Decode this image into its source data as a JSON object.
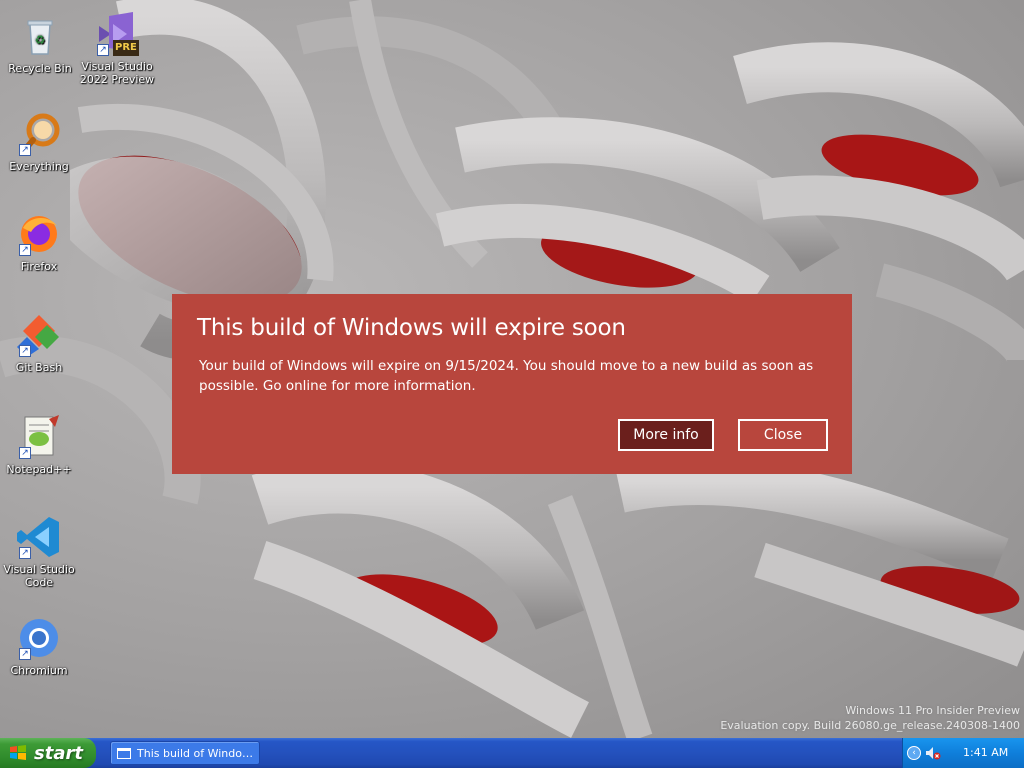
{
  "desktop": {
    "icons": [
      {
        "label": "Recycle Bin",
        "icon": "recycle-bin-icon"
      },
      {
        "label": "Visual Studio 2022 Preview",
        "icon": "visual-studio-preview-icon",
        "badge": "PRE"
      },
      {
        "label": "Everything",
        "icon": "everything-search-icon"
      },
      {
        "label": "Firefox",
        "icon": "firefox-icon"
      },
      {
        "label": "Git Bash",
        "icon": "git-bash-icon"
      },
      {
        "label": "Notepad++",
        "icon": "notepad-plus-plus-icon"
      },
      {
        "label": "Visual Studio Code",
        "icon": "vscode-icon"
      },
      {
        "label": "Chromium",
        "icon": "chromium-icon"
      }
    ]
  },
  "dialog": {
    "title": "This build of Windows will expire soon",
    "message": "Your build of Windows will expire on 9/15/2024. You should move to a new build as soon as possible. Go online for more information.",
    "more_info_label": "More info",
    "close_label": "Close",
    "background_color": "#b8463d",
    "primary_button_color": "#6b1f1c"
  },
  "watermark": {
    "line1": "Windows 11 Pro Insider Preview",
    "line2": "Evaluation copy. Build 26080.ge_release.240308-1400"
  },
  "taskbar": {
    "start_label": "start",
    "task_button_label": "This build of Windows...",
    "clock": "1:41 AM",
    "tray_icons": [
      "show-hidden-icons-chevron",
      "volume-muted-icon"
    ]
  }
}
